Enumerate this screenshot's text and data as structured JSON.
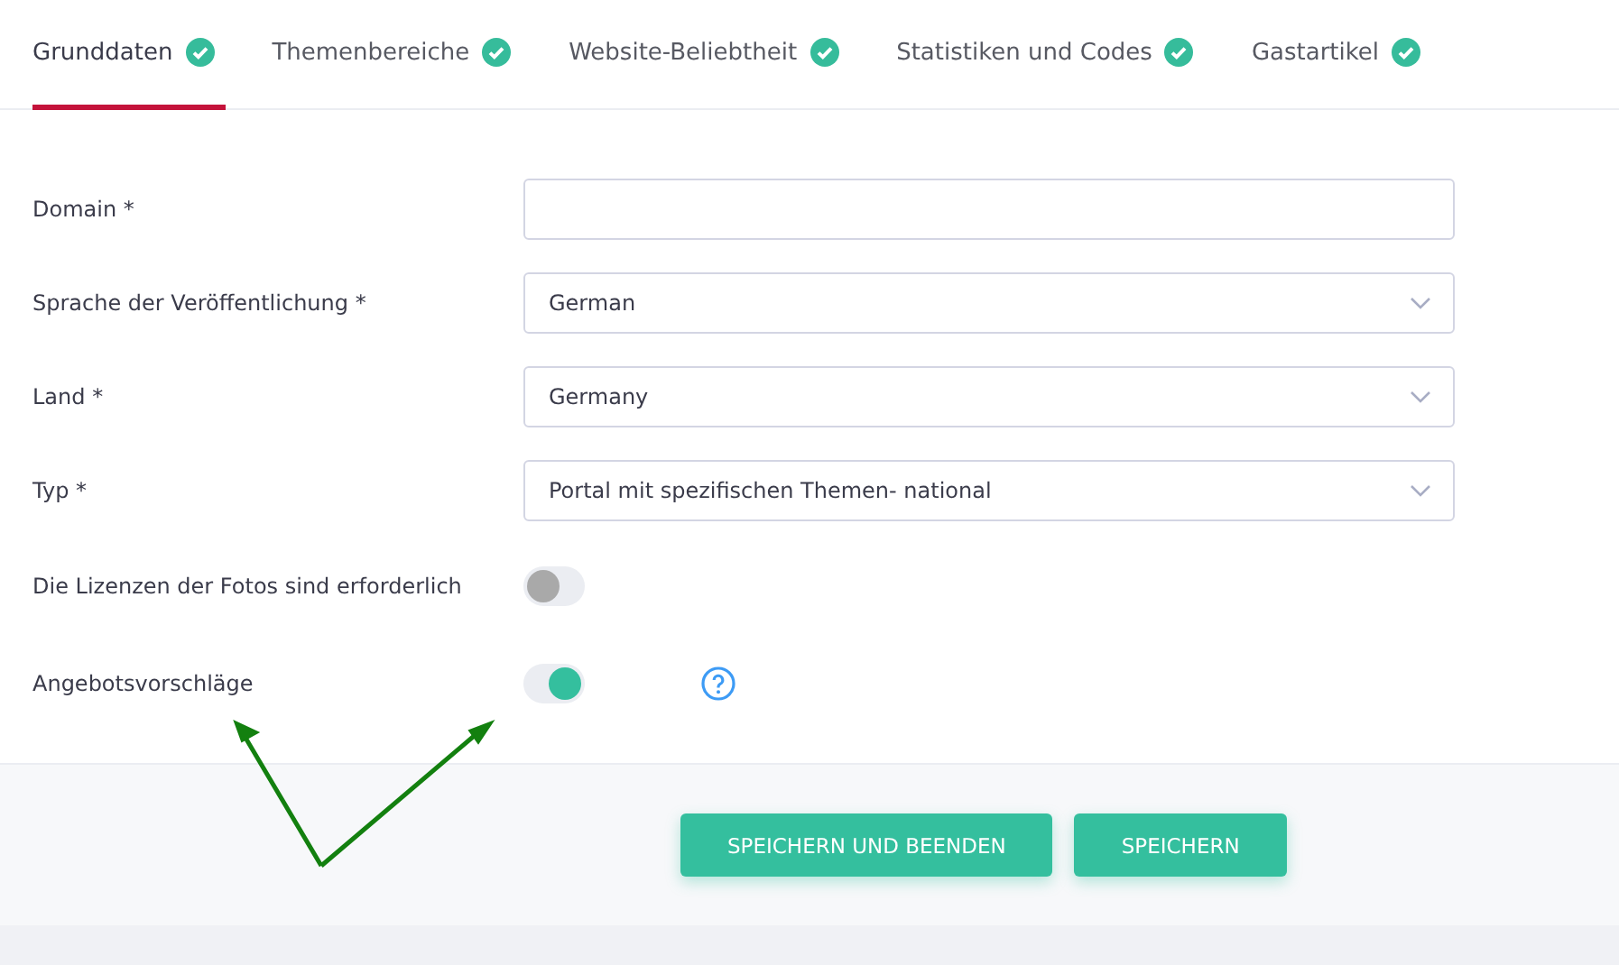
{
  "tabs": [
    {
      "label": "Grunddaten",
      "selected": true,
      "completed": true
    },
    {
      "label": "Themenbereiche",
      "selected": false,
      "completed": true
    },
    {
      "label": "Website-Beliebtheit",
      "selected": false,
      "completed": true
    },
    {
      "label": "Statistiken und Codes",
      "selected": false,
      "completed": true
    },
    {
      "label": "Gastartikel",
      "selected": false,
      "completed": true
    }
  ],
  "fields": [
    {
      "kind": "text",
      "label": "Domain *"
    },
    {
      "kind": "select",
      "label": "Sprache der Veröffentlichung *",
      "value": "German"
    },
    {
      "kind": "select",
      "label": "Land *",
      "value": "Germany"
    },
    {
      "kind": "select",
      "label": "Typ *",
      "value": "Portal mit spezifischen Themen- national"
    },
    {
      "kind": "toggle",
      "label": "Die Lizenzen der Fotos sind erforderlich",
      "on": false,
      "help": false
    },
    {
      "kind": "toggle",
      "label": "Angebotsvorschläge",
      "on": true,
      "help": true
    }
  ],
  "buttons": [
    "SPEICHERN UND BEENDEN",
    "SPEICHERN"
  ]
}
